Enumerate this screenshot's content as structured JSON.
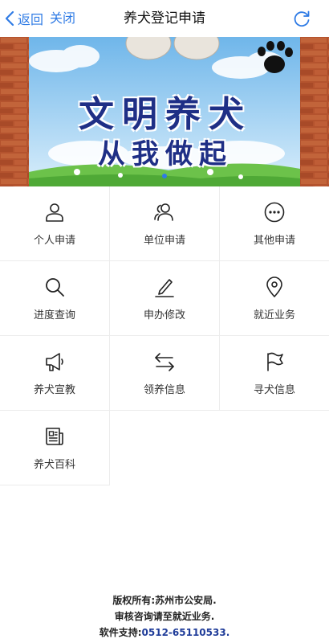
{
  "nav": {
    "back_label": "返回",
    "close_label": "关闭",
    "title": "养犬登记申请"
  },
  "banner": {
    "slogan_line1": "文明养犬",
    "slogan_line2": "从我做起",
    "slide_count": 1,
    "active_slide": 1
  },
  "menu": [
    {
      "label": "个人申请",
      "icon": "person-icon"
    },
    {
      "label": "单位申请",
      "icon": "group-icon"
    },
    {
      "label": "其他申请",
      "icon": "more-icon"
    },
    {
      "label": "进度查询",
      "icon": "search-icon"
    },
    {
      "label": "申办修改",
      "icon": "edit-icon"
    },
    {
      "label": "就近业务",
      "icon": "location-icon"
    },
    {
      "label": "养犬宣教",
      "icon": "megaphone-icon"
    },
    {
      "label": "领养信息",
      "icon": "transfer-icon"
    },
    {
      "label": "寻犬信息",
      "icon": "flag-icon"
    },
    {
      "label": "养犬百科",
      "icon": "news-icon"
    }
  ],
  "footer": {
    "line1": "版权所有:苏州市公安局.",
    "line2": "审核咨询请至就近业务.",
    "line3_prefix": "软件支持:",
    "phone": "0512-65110533."
  },
  "colors": {
    "accent": "#2f7be5",
    "slogan": "#1f2f86",
    "phone": "#1f3c99"
  }
}
